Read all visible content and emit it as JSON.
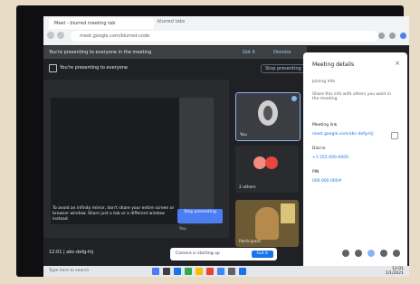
{
  "browser": {
    "tab_title": "Meet - blurred meeting tab",
    "tabs_right": "blurred tabs",
    "url": "meet.google.com/blurred-code"
  },
  "banner": {
    "text": "You're presenting to everyone in the meeting",
    "action1": "Got it",
    "action2": "Dismiss"
  },
  "presenting": {
    "text": "You're presenting to everyone",
    "stop": "Stop presenting"
  },
  "stage": {
    "message": "To avoid an infinity mirror, don't share your entire screen or browser window. Share just a tab or a different window instead.",
    "button": "Stop presenting",
    "label": "You"
  },
  "tiles": [
    {
      "name": "You",
      "pinned": true
    },
    {
      "name": "2 others"
    },
    {
      "name": "Participant"
    }
  ],
  "panel": {
    "title": "Meeting details",
    "subtitle": "Joining info",
    "desc": "Share this info with others you want in the meeting",
    "link_label": "Meeting link",
    "link_value": "meet.google.com/abc-defg-hij",
    "dial_label": "Dial-in",
    "dial_value": "+1 555-000-0000",
    "pin_label": "PIN",
    "pin_value": "000 000 000#"
  },
  "bottom": {
    "meet_code": "12:01 | abc-defg-hij"
  },
  "toast": {
    "text": "Camera is starting up",
    "button": "Got it"
  },
  "taskbar": {
    "search": "Type here to search",
    "time": "12:01",
    "date": "1/1/2021"
  }
}
